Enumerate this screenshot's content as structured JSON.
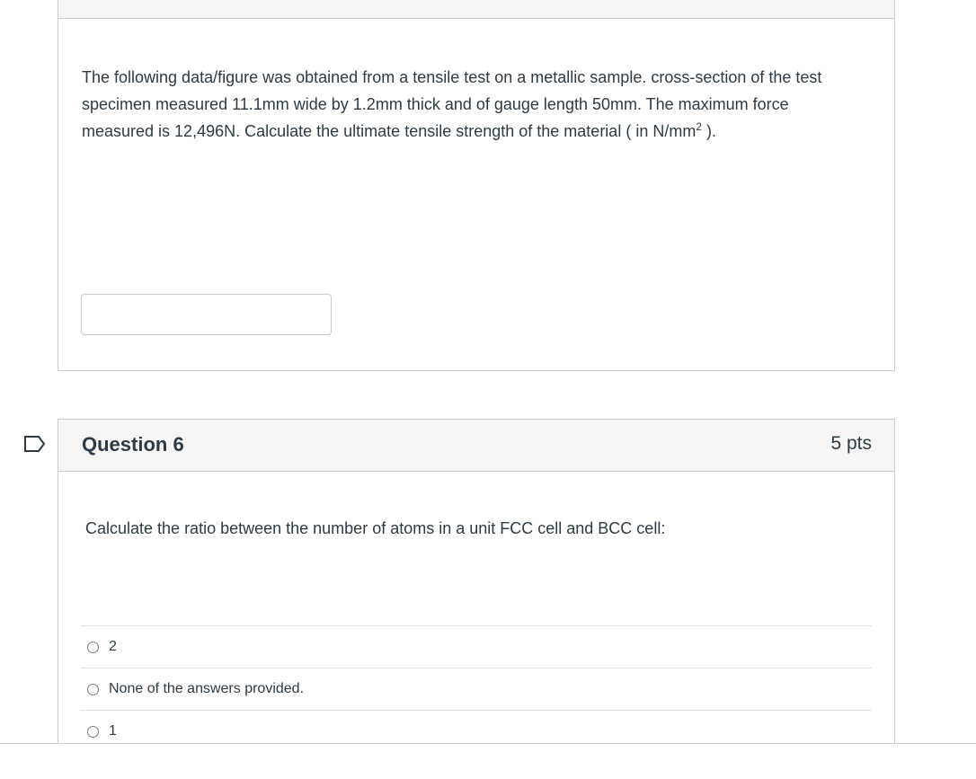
{
  "question5": {
    "text_main": "The following data/figure was obtained from a tensile test on a metallic sample. cross-section of the test specimen measured  11.1mm wide by 1.2mm thick and of gauge length 50mm.  The maximum force measured is 12,496N. Calculate the ultimate tensile strength of the material ( in N/mm",
    "text_sup": "2",
    "text_end": " ).",
    "answer_value": ""
  },
  "question6": {
    "title": "Question 6",
    "points": "5 pts",
    "text": "Calculate the ratio between the number of atoms in a unit FCC cell and BCC cell:",
    "answers": [
      "2",
      "None of the answers provided.",
      "1"
    ]
  },
  "icons": {
    "flag": "flag-question-icon"
  },
  "colors": {
    "text": "#2d3b45",
    "border": "#c7cdd1",
    "header_bg": "#f5f5f5",
    "flag": "#2d3b45"
  }
}
